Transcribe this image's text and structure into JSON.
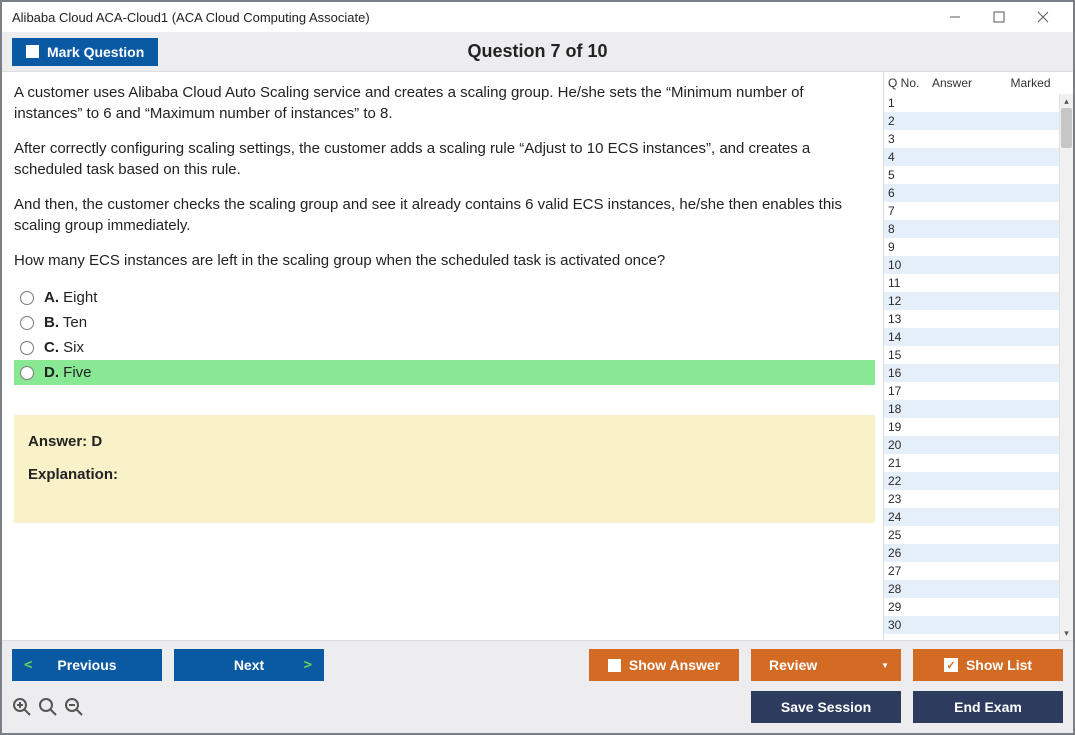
{
  "window": {
    "title": "Alibaba Cloud ACA-Cloud1 (ACA Cloud Computing Associate)"
  },
  "toolbar": {
    "mark_label": "Mark Question",
    "question_title": "Question 7 of 10"
  },
  "question": {
    "paragraphs": [
      "A customer uses Alibaba Cloud Auto Scaling service and creates a scaling group. He/she sets the “Minimum number of instances” to 6 and “Maximum number of instances” to 8.",
      "After correctly configuring scaling settings, the customer adds a scaling rule “Adjust to 10 ECS instances”, and creates a scheduled task based on this rule.",
      "And then, the customer checks the scaling group and see it already contains 6 valid ECS instances, he/she then enables this scaling group immediately.",
      "How many ECS instances are left in the scaling group when the scheduled task is activated once?"
    ],
    "options": [
      {
        "letter": "A.",
        "text": "Eight",
        "highlight": false
      },
      {
        "letter": "B.",
        "text": "Ten",
        "highlight": false
      },
      {
        "letter": "C.",
        "text": "Six",
        "highlight": false
      },
      {
        "letter": "D.",
        "text": "Five",
        "highlight": true
      }
    ],
    "answer_line": "Answer: D",
    "explanation_label": "Explanation:"
  },
  "side": {
    "headers": {
      "qno": "Q No.",
      "answer": "Answer",
      "marked": "Marked"
    },
    "rows": [
      1,
      2,
      3,
      4,
      5,
      6,
      7,
      8,
      9,
      10,
      11,
      12,
      13,
      14,
      15,
      16,
      17,
      18,
      19,
      20,
      21,
      22,
      23,
      24,
      25,
      26,
      27,
      28,
      29,
      30
    ]
  },
  "footer": {
    "previous": "Previous",
    "next": "Next",
    "show_answer": "Show Answer",
    "review": "Review",
    "show_list": "Show List",
    "save_session": "Save Session",
    "end_exam": "End Exam"
  }
}
